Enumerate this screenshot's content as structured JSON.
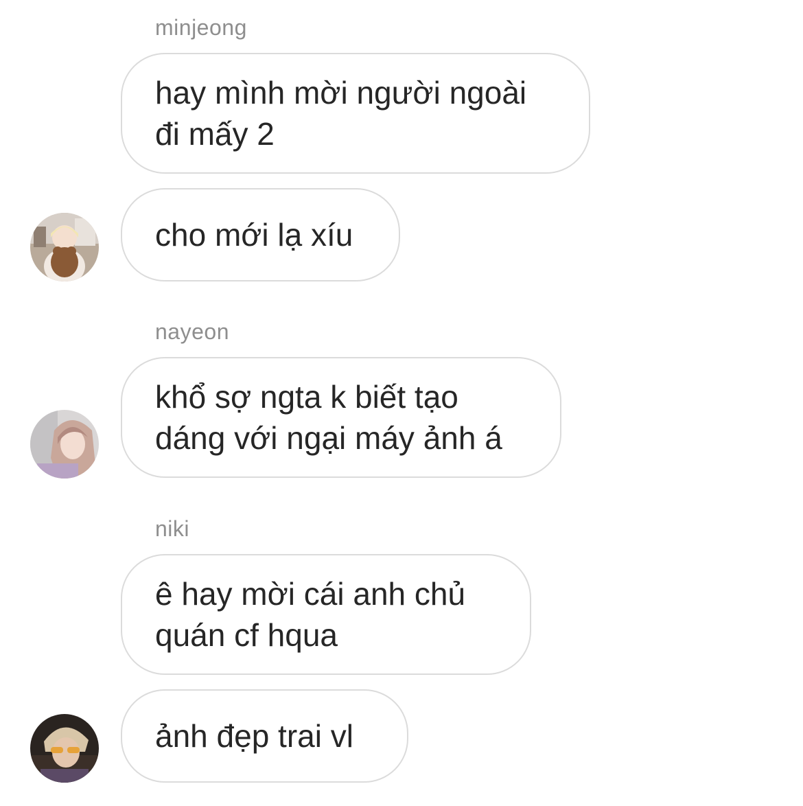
{
  "chat": {
    "groups": [
      {
        "sender": "minjeong",
        "messages": [
          {
            "lines": [
              "hay mình mời người ngoài",
              "đi mấy 2"
            ]
          },
          {
            "lines": [
              "cho mới lạ xíu"
            ]
          }
        ],
        "avatar": "minjeong-avatar"
      },
      {
        "sender": "nayeon",
        "messages": [
          {
            "lines": [
              "khổ sợ ngta k biết tạo",
              "dáng với ngại máy ảnh á"
            ]
          }
        ],
        "avatar": "nayeon-avatar"
      },
      {
        "sender": "niki",
        "messages": [
          {
            "lines": [
              "ê hay mời cái anh chủ",
              "quán cf hqua"
            ]
          },
          {
            "lines": [
              "ảnh đẹp trai vl"
            ]
          }
        ],
        "avatar": "niki-avatar"
      }
    ]
  },
  "colors": {
    "bubble_border": "#dbdbdb",
    "sender_text": "#8e8e8e",
    "message_text": "#262626"
  }
}
